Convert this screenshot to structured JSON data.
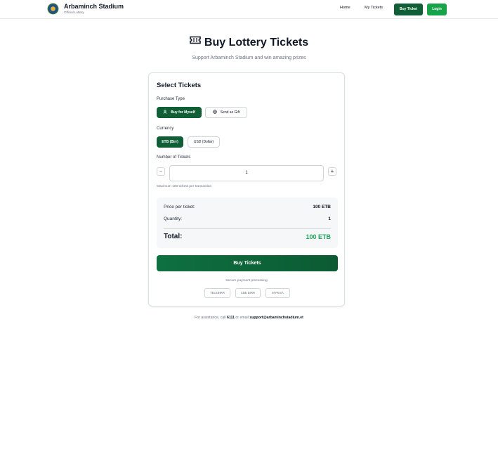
{
  "nav": {
    "brand_title": "Arbaminch Stadium",
    "brand_subtitle": "Official Lottery",
    "links": [
      "Home",
      "My Tickets"
    ],
    "buy_ticket_label": "Buy Ticket",
    "login_label": "Login"
  },
  "header": {
    "title": "Buy Lottery Tickets",
    "subtitle": "Support Arbaminch Stadium and win amazing prizes"
  },
  "card": {
    "title": "Select Tickets",
    "purchase_type_label": "Purchase Type",
    "purchase_options": [
      "Buy for Myself",
      "Send as Gift"
    ],
    "currency_label": "Currency",
    "currency_options": [
      "ETB (Birr)",
      "USD (Dollar)"
    ],
    "tickets_label": "Number of Tickets",
    "decrement": "−",
    "increment": "+",
    "quantity": "1",
    "max_hint": "Maximum 100 tickets per transaction",
    "summary": {
      "price_label": "Price per ticket:",
      "price_value": "100 ETB",
      "quantity_label": "Quantity:",
      "quantity_value": "1",
      "total_label": "Total:",
      "total_value": "100 ETB"
    },
    "buy_button": "Buy Tickets",
    "secure_text": "Secure payment processing",
    "payment_methods": [
      "TELEBIRR",
      "CBE BIRR",
      "M-PESA"
    ]
  },
  "footer": {
    "prefix": "For assistance, call",
    "phone": "6111",
    "middle": "or email",
    "email": "support@arbaminchstadium.et"
  },
  "colors": {
    "primary_green": "#0f5e35",
    "login_green": "#16a34a",
    "total_green": "#22a55a"
  }
}
